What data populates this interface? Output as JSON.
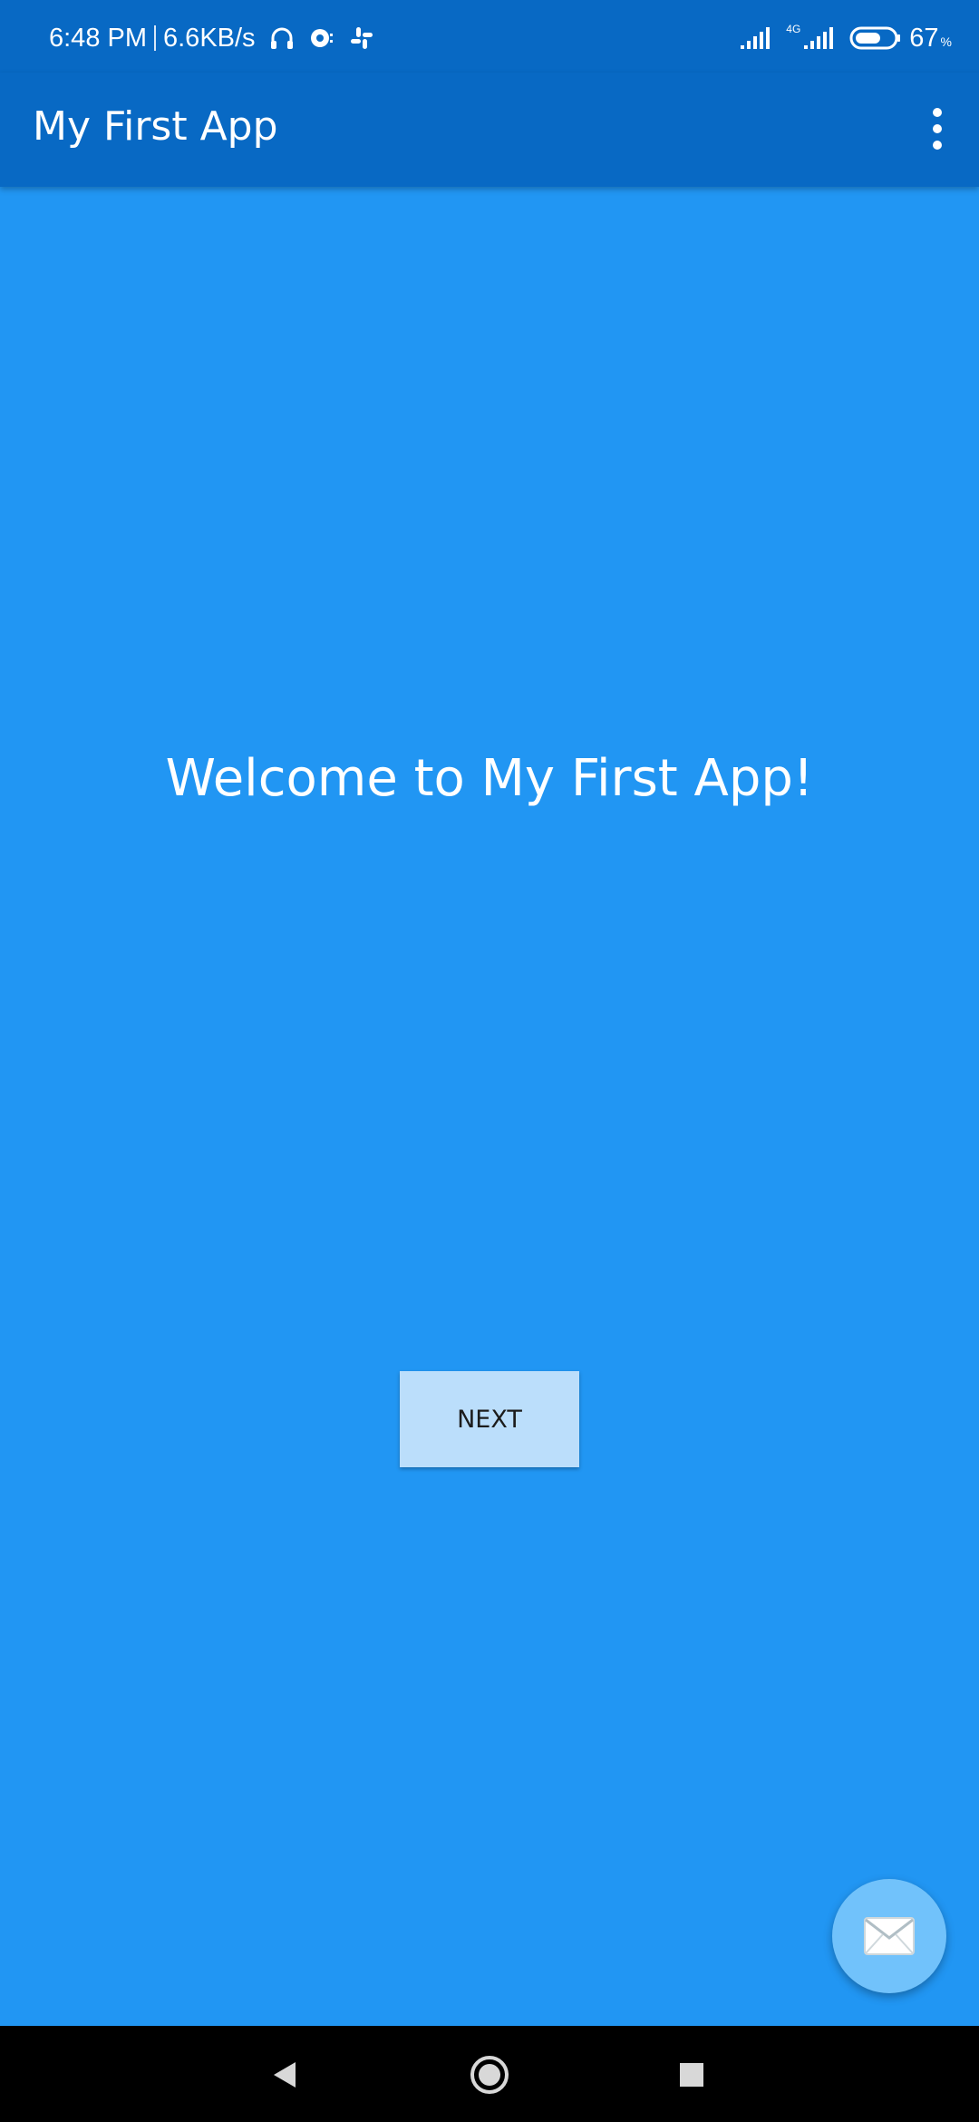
{
  "status_bar": {
    "time": "6:48 PM",
    "net_speed": "6.6KB/s",
    "network_type": "4G",
    "battery_percent": "67",
    "battery_unit": "%",
    "battery_level": 0.67,
    "icons": [
      "headset-icon",
      "sync-notification-icon",
      "slack-icon",
      "signal-icon",
      "signal-4g-icon",
      "battery-icon"
    ]
  },
  "app_bar": {
    "title": "My First App",
    "menu_icon": "overflow-menu-icon"
  },
  "main": {
    "welcome_text": "Welcome to My First App!",
    "next_button_label": "NEXT"
  },
  "fab": {
    "icon": "email-icon"
  },
  "nav_bar": {
    "icons": [
      "back-icon",
      "home-icon",
      "recents-icon"
    ]
  },
  "colors": {
    "primary_dark": "#0869C4",
    "background": "#2196F3",
    "button": "#BBDEFB",
    "fab": "#71C2FB"
  }
}
